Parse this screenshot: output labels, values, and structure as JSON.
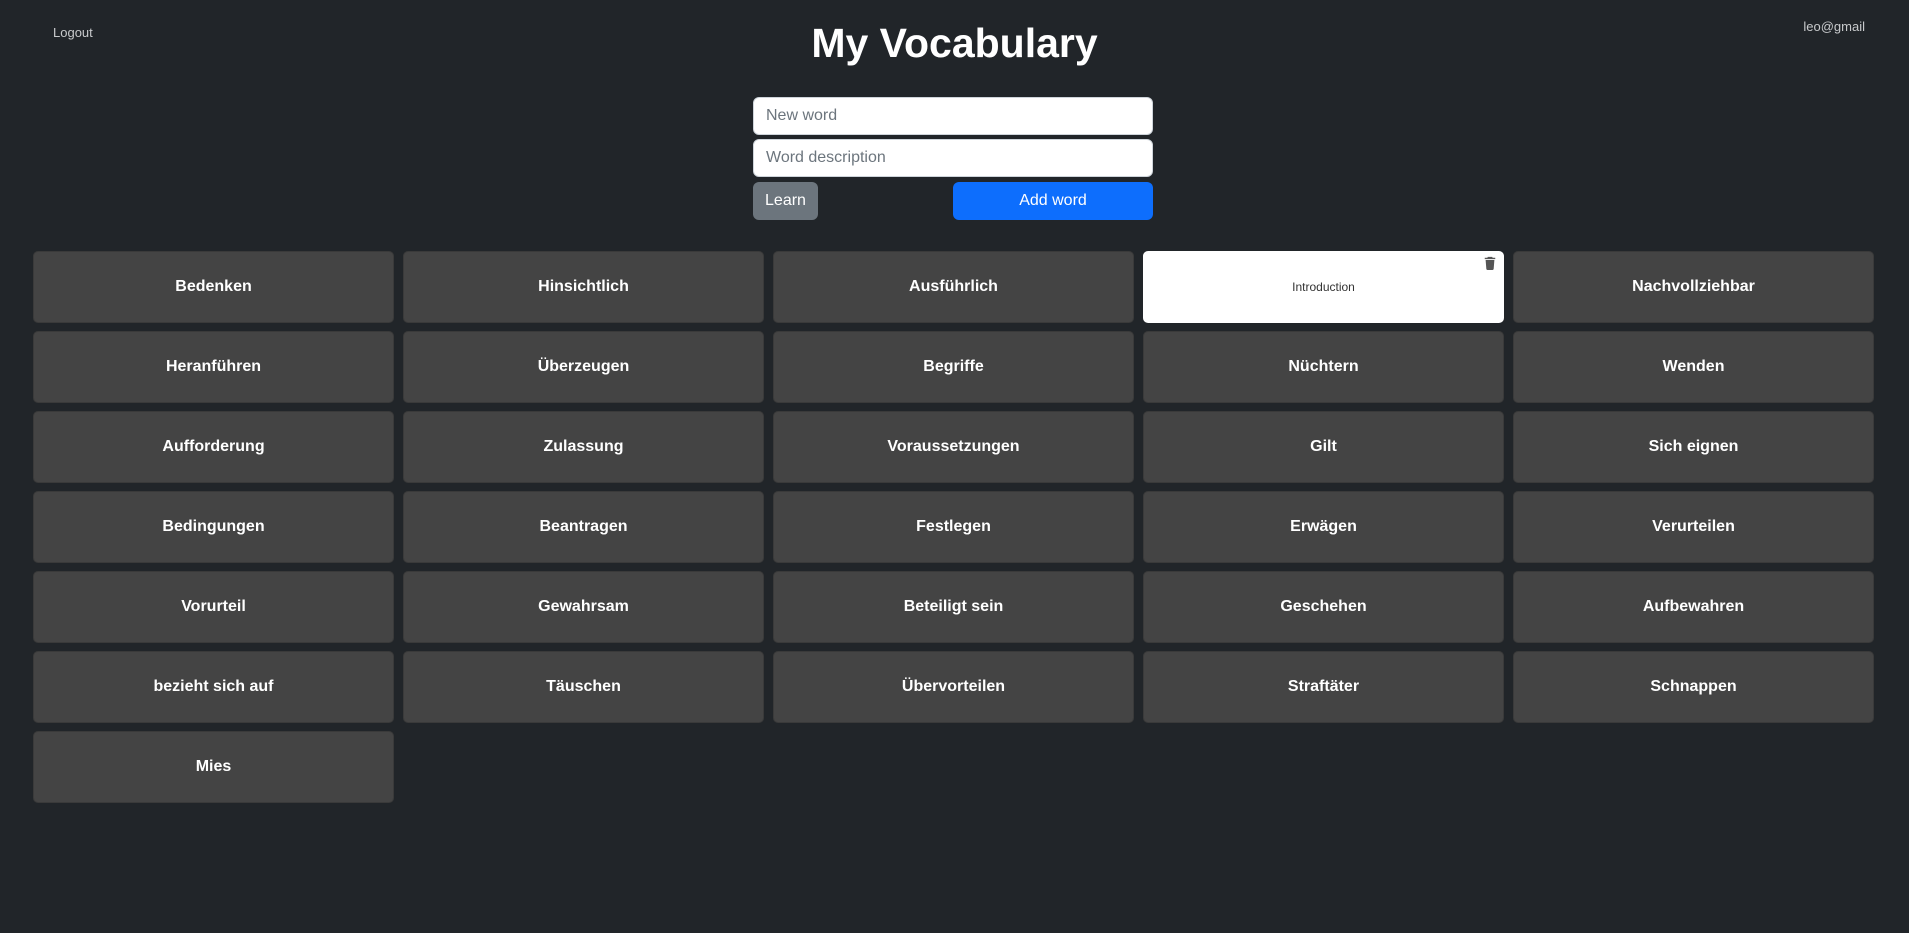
{
  "header": {
    "logout_label": "Logout",
    "title": "My Vocabulary",
    "user_email": "leo@gmail"
  },
  "form": {
    "new_word_placeholder": "New word",
    "new_word_value": "",
    "description_placeholder": "Word description",
    "description_value": "",
    "learn_label": "Learn",
    "add_label": "Add word"
  },
  "colors": {
    "background": "#212529",
    "card": "#444444",
    "primary": "#0d6efd",
    "secondary": "#6c757d"
  },
  "words": [
    {
      "label": "Bedenken"
    },
    {
      "label": "Hinsichtlich"
    },
    {
      "label": "Ausführlich"
    },
    {
      "label": "Introduction",
      "flipped": true,
      "icon": "trash-icon"
    },
    {
      "label": "Nachvollziehbar"
    },
    {
      "label": "Heranführen"
    },
    {
      "label": "Überzeugen"
    },
    {
      "label": "Begriffe"
    },
    {
      "label": "Nüchtern"
    },
    {
      "label": "Wenden"
    },
    {
      "label": "Aufforderung"
    },
    {
      "label": "Zulassung"
    },
    {
      "label": "Voraussetzungen"
    },
    {
      "label": "Gilt"
    },
    {
      "label": "Sich eignen"
    },
    {
      "label": "Bedingungen"
    },
    {
      "label": "Beantragen"
    },
    {
      "label": "Festlegen"
    },
    {
      "label": "Erwägen"
    },
    {
      "label": "Verurteilen"
    },
    {
      "label": "Vorurteil"
    },
    {
      "label": "Gewahrsam"
    },
    {
      "label": "Beteiligt sein"
    },
    {
      "label": "Geschehen"
    },
    {
      "label": "Aufbewahren"
    },
    {
      "label": "bezieht sich auf"
    },
    {
      "label": "Täuschen"
    },
    {
      "label": "Übervorteilen"
    },
    {
      "label": "Straftäter"
    },
    {
      "label": "Schnappen"
    },
    {
      "label": "Mies"
    }
  ]
}
